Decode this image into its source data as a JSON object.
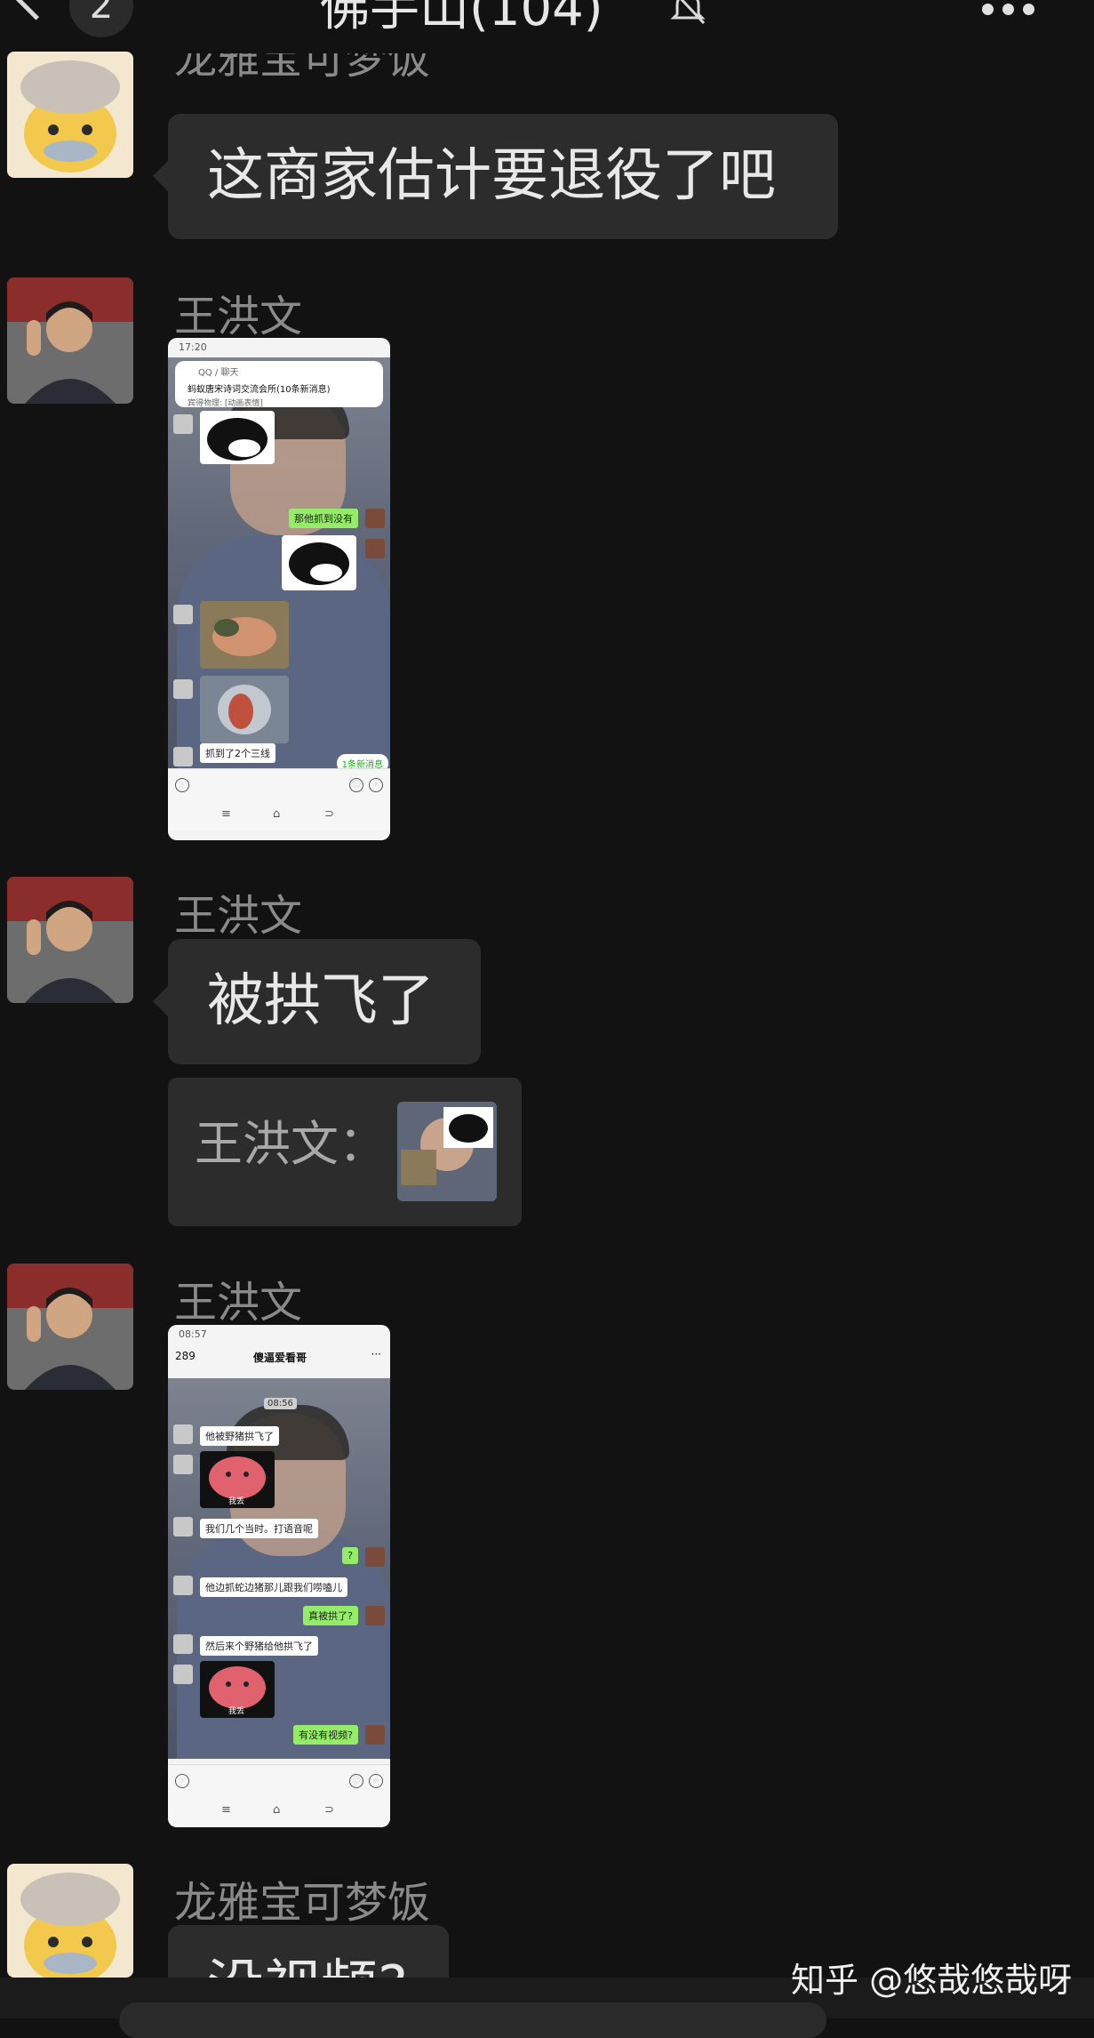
{
  "header": {
    "unread_count": "2",
    "title": "佛手山(104)"
  },
  "messages": [
    {
      "sender": "龙雅宝可梦饭",
      "text": "这商家估计要退役了吧"
    },
    {
      "sender": "王洪文"
    },
    {
      "sender": "王洪文",
      "text": "被拱飞了",
      "quote_label": "王洪文："
    },
    {
      "sender": "王洪文"
    },
    {
      "sender": "龙雅宝可梦饭",
      "text": "没视频?"
    }
  ],
  "shot1": {
    "status_time": "17:20",
    "breadcrumb": "QQ / 聊天",
    "notif_title": "蚂蚁唐宋诗词交流会所(10条新消息)",
    "notif_body": "宾得物理: [动画表情]",
    "green_msg": "那他抓到没有",
    "white_msg": "抓到了2个三线",
    "new_msgs": "1条新消息"
  },
  "shot2": {
    "status_time": "08:57",
    "back_count": "289",
    "chat_title": "傻逼爱看哥",
    "time_label": "08:56",
    "msgs": [
      "他被野猪拱飞了",
      "我们几个当时。打语音呢",
      "?",
      "他边抓蛇边猪那儿跟我们唠嗑儿",
      "真被拱了?",
      "然后来个野猪给他拱飞了",
      "有没有视频?"
    ],
    "sticker_caption": "我丢"
  },
  "watermark": "知乎 @悠哉悠哉呀"
}
